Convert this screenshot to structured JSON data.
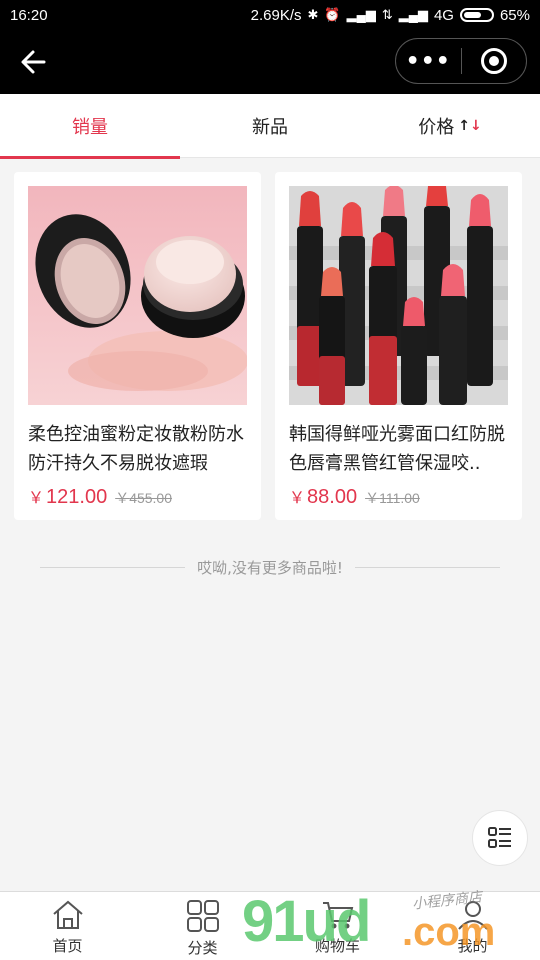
{
  "status_bar": {
    "time": "16:20",
    "speed": "2.69K/s",
    "network": "4G",
    "battery_percent": "65%",
    "battery_level": 0.65
  },
  "nav": {
    "more_label": "•••"
  },
  "tabs": [
    {
      "label": "销量",
      "active": true
    },
    {
      "label": "新品",
      "active": false
    },
    {
      "label": "价格",
      "active": false
    }
  ],
  "products": [
    {
      "title": "柔色控油蜜粉定妆散粉防水防汗持久不易脱妆遮瑕",
      "price": "121.00",
      "original_price": "455.00",
      "currency": "￥"
    },
    {
      "title": "韩国得鲜哑光雾面口红防脱色唇膏黑管红管保湿咬..",
      "price": "88.00",
      "original_price": "111.00",
      "currency": "￥"
    }
  ],
  "end_text": "哎呦,没有更多商品啦!",
  "tabbar": [
    {
      "label": "首页",
      "icon": "home-icon"
    },
    {
      "label": "分类",
      "icon": "grid-icon"
    },
    {
      "label": "购物车",
      "icon": "cart-icon"
    },
    {
      "label": "我的",
      "icon": "user-icon"
    }
  ],
  "watermark": {
    "big": "91ud",
    "domain": ".com",
    "sub": "小程序商店"
  },
  "colors": {
    "accent": "#e2364d",
    "bar_black": "#000000"
  }
}
